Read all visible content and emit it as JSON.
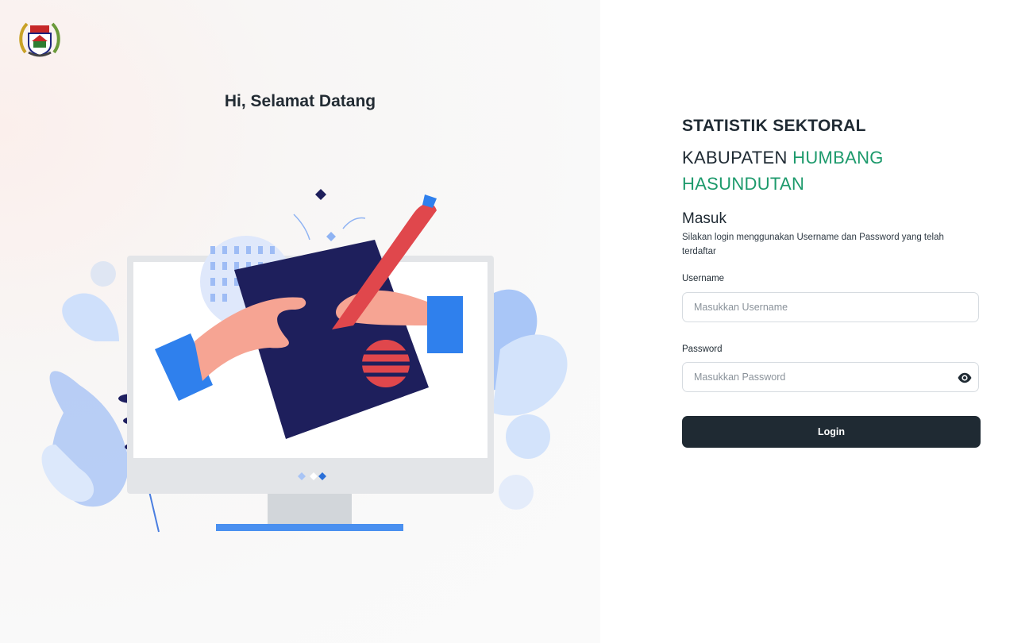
{
  "left": {
    "welcome": "Hi, Selamat Datang",
    "logo_icon": "regency-emblem-icon",
    "illustration_icon": "monitor-signing-illustration"
  },
  "brand": {
    "line1": "STATISTIK SEKTORAL",
    "line2_prefix": "KABUPATEN",
    "line2_accent": "HUMBANG HASUNDUTAN",
    "accent_color": "#1d9a6c"
  },
  "form": {
    "heading": "Masuk",
    "description": "Silakan login menggunakan Username dan Password yang telah terdaftar",
    "username": {
      "label": "Username",
      "placeholder": "Masukkan Username",
      "value": ""
    },
    "password": {
      "label": "Password",
      "placeholder": "Masukkan Password",
      "value": "",
      "toggle_icon": "eye-icon"
    },
    "submit_label": "Login",
    "button_color": "#1f2a33"
  }
}
